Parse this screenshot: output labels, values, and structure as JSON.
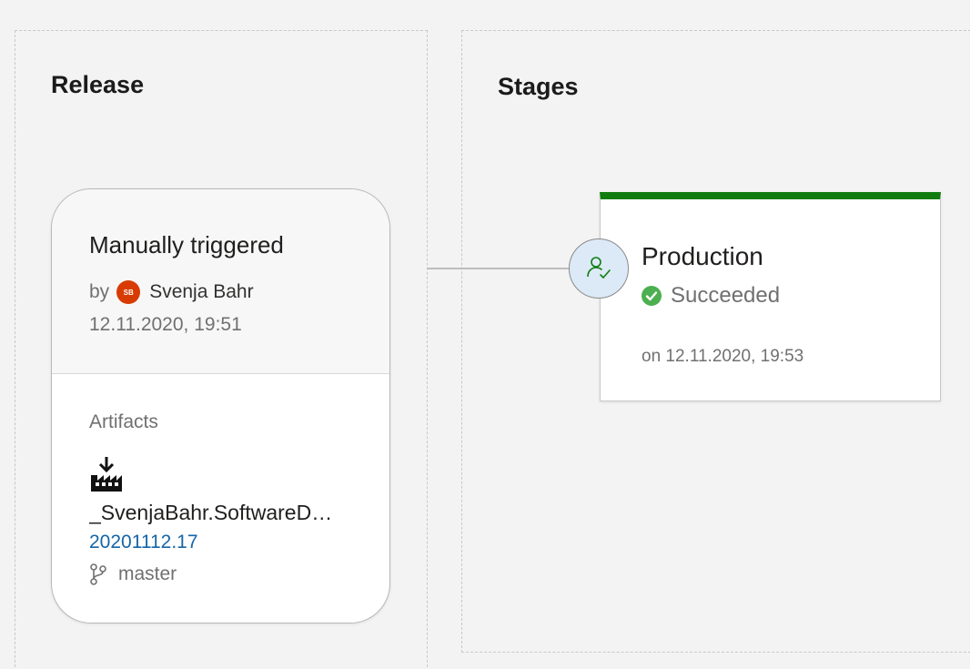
{
  "release": {
    "title": "Release",
    "trigger": "Manually triggered",
    "by_label": "by",
    "user": {
      "initials": "SB",
      "name": "Svenja Bahr",
      "avatar_color": "#d83b01"
    },
    "date": "12.11.2020, 19:51",
    "artifacts_label": "Artifacts",
    "artifact": {
      "icon": "build-artifact-icon",
      "name": "_SvenjaBahr.SoftwareD…",
      "version": "20201112.17",
      "branch_icon": "git-branch-icon",
      "branch": "master"
    }
  },
  "stages": {
    "title": "Stages",
    "approval_icon": "approver-check-icon",
    "items": [
      {
        "name": "Production",
        "status": "Succeeded",
        "status_color": "#107c10",
        "status_icon": "success-check-icon",
        "date": "on 12.11.2020, 19:53"
      }
    ]
  },
  "colors": {
    "background": "#f3f3f3",
    "success": "#107c10",
    "link": "#1565a8"
  }
}
